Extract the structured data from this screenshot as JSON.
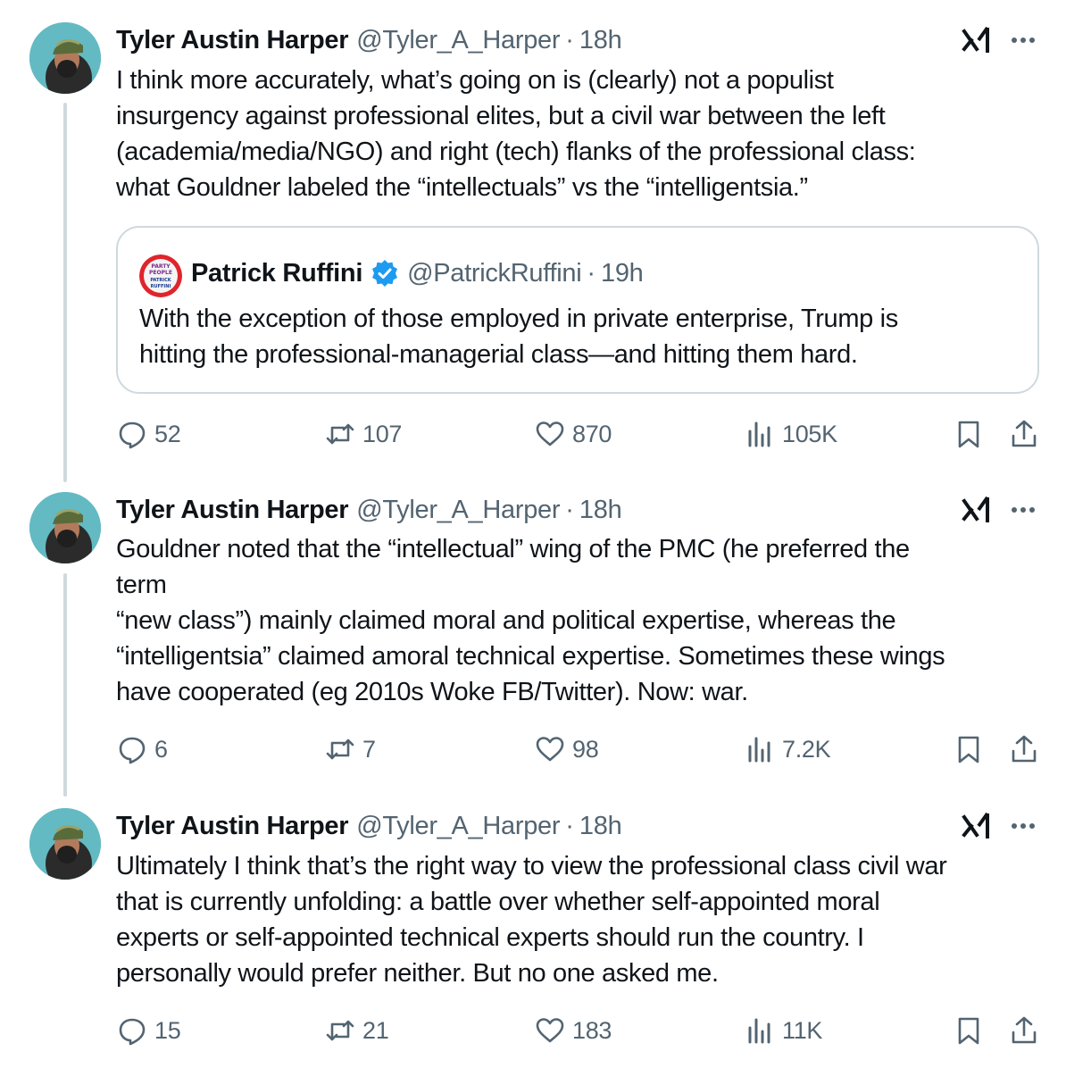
{
  "tweets": [
    {
      "author": {
        "name": "Tyler Austin Harper",
        "handle": "@Tyler_A_Harper"
      },
      "time": "18h",
      "text": "I think more accurately, what’s going on is (clearly) not a populist\ninsurgency against professional elites, but a civil war between the left\n(academia/media/NGO) and right (tech) flanks of the professional class:\nwhat Gouldner labeled the “intellectuals” vs the “intelligentsia.”",
      "quote": {
        "author": {
          "name": "Patrick Ruffini",
          "handle": "@PatrickRuffini"
        },
        "time": "19h",
        "text": "With the exception of those employed in private enterprise, Trump is\nhitting the professional-managerial class—and hitting them hard.",
        "avatar_text": [
          "PARTY",
          "PEOPLE",
          "PATRICK",
          "RUFFINI"
        ]
      },
      "stats": {
        "replies": "52",
        "reposts": "107",
        "likes": "870",
        "views": "105K"
      }
    },
    {
      "author": {
        "name": "Tyler Austin Harper",
        "handle": "@Tyler_A_Harper"
      },
      "time": "18h",
      "text": "Gouldner noted that the “intellectual” wing of the PMC (he preferred the\nterm\n“new class”) mainly claimed moral and political expertise, whereas the\n“intelligentsia” claimed amoral technical expertise. Sometimes these wings\nhave cooperated (eg 2010s Woke FB/Twitter). Now: war.",
      "stats": {
        "replies": "6",
        "reposts": "7",
        "likes": "98",
        "views": "7.2K"
      }
    },
    {
      "author": {
        "name": "Tyler Austin Harper",
        "handle": "@Tyler_A_Harper"
      },
      "time": "18h",
      "text": "Ultimately I think that’s the right way to view the professional class civil war\nthat is currently unfolding: a battle over whether self-appointed moral\nexperts or self-appointed technical experts should run the country. I\npersonally would prefer neither. But no one asked me.",
      "stats": {
        "replies": "15",
        "reposts": "21",
        "likes": "183",
        "views": "11K"
      }
    }
  ],
  "separator": "·",
  "icons": {
    "grok": "grok-icon",
    "more": "more-icon",
    "reply": "reply-icon",
    "repost": "repost-icon",
    "like": "heart-icon",
    "views": "views-icon",
    "bookmark": "bookmark-icon",
    "share": "share-icon",
    "verified": "verified-badge-icon"
  },
  "colors": {
    "text": "#0f1419",
    "secondary": "#536471",
    "border": "#cfd9de",
    "verified": "#1d9bf0"
  }
}
